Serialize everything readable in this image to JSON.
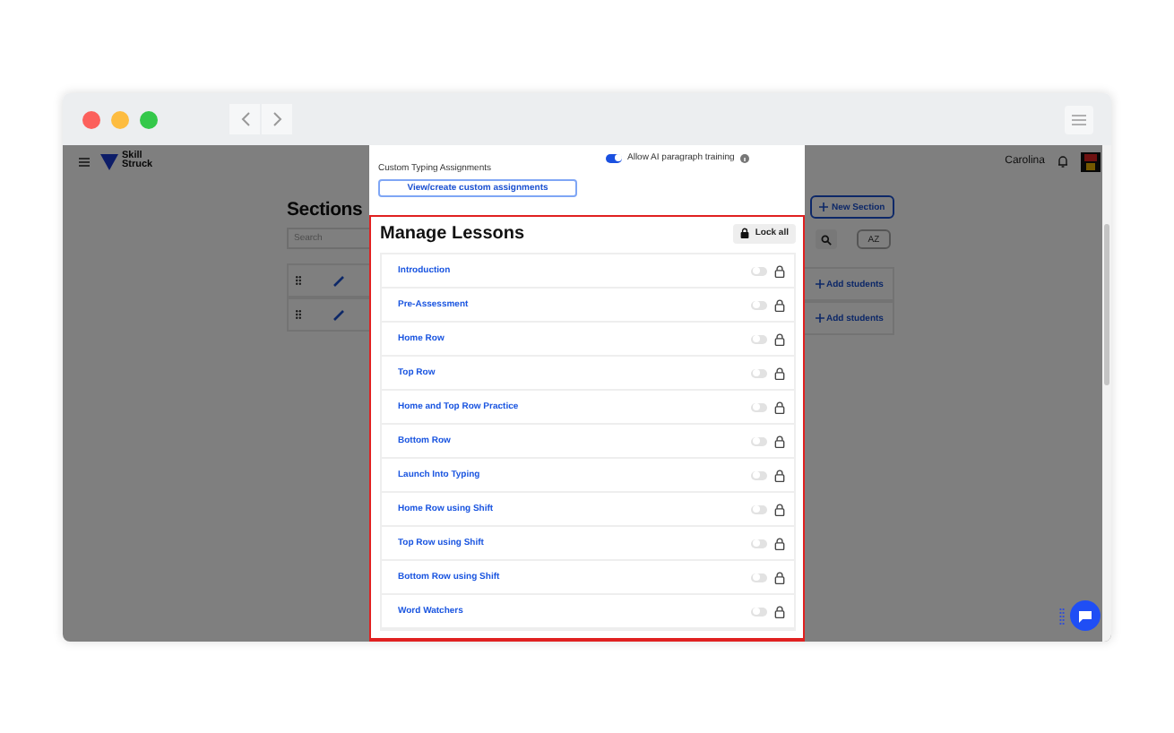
{
  "app_header": {
    "brand_lines": [
      "Skill",
      "Struck"
    ],
    "user_name": "Carolina"
  },
  "sections": {
    "title": "Sections",
    "search_placeholder": "Search",
    "new_section_label": "New Section",
    "sort_label": "AZ",
    "rows": [
      {
        "add_label": "Add students"
      },
      {
        "add_label": "Add students"
      }
    ]
  },
  "panel": {
    "ai_training": {
      "label": "Allow AI paragraph training",
      "on": true
    },
    "custom_heading": "Custom Typing Assignments",
    "custom_button": "View/create custom assignments",
    "manage": {
      "title": "Manage Lessons",
      "lock_all": "Lock all",
      "lessons": [
        {
          "name": "Introduction",
          "on": false
        },
        {
          "name": "Pre-Assessment",
          "on": false
        },
        {
          "name": "Home Row",
          "on": false
        },
        {
          "name": "Top Row",
          "on": false
        },
        {
          "name": "Home and Top Row Practice",
          "on": false
        },
        {
          "name": "Bottom Row",
          "on": false
        },
        {
          "name": "Launch Into Typing",
          "on": false
        },
        {
          "name": "Home Row using Shift",
          "on": false
        },
        {
          "name": "Top Row using Shift",
          "on": false
        },
        {
          "name": "Bottom Row using Shift",
          "on": false
        },
        {
          "name": "Word Watchers",
          "on": false
        }
      ]
    }
  }
}
